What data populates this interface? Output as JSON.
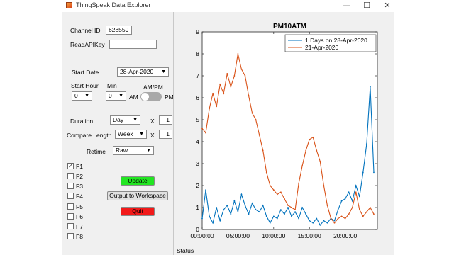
{
  "window": {
    "title": "ThingSpeak Data Explorer"
  },
  "controls": {
    "channel_id_label": "Channel ID",
    "channel_id_value": "628559",
    "read_api_key_label": "ReadAPIKey",
    "read_api_key_value": "",
    "start_date_label": "Start Date",
    "start_date_value": "28-Apr-2020",
    "start_hour_label": "Start Hour",
    "start_hour_value": "0",
    "min_label": "Min",
    "min_value": "0",
    "ampm_label": "AM/PM",
    "am_label": "AM",
    "pm_label": "PM",
    "toggle_state": "AM",
    "duration_label": "Duration",
    "duration_value": "Day",
    "duration_x": "X",
    "duration_count": "1",
    "compare_label": "Compare Length",
    "compare_value": "Week",
    "compare_x": "X",
    "compare_count": "1",
    "retime_label": "Retime",
    "retime_value": "Raw",
    "fields": [
      {
        "label": "F1",
        "checked": true
      },
      {
        "label": "F2",
        "checked": false
      },
      {
        "label": "F3",
        "checked": false
      },
      {
        "label": "F4",
        "checked": false
      },
      {
        "label": "F5",
        "checked": false
      },
      {
        "label": "F6",
        "checked": false
      },
      {
        "label": "F7",
        "checked": false
      },
      {
        "label": "F8",
        "checked": false
      }
    ],
    "update_label": "Update",
    "output_label": "Output to Workspace",
    "quit_label": "Quit",
    "update_color": "#22e622",
    "quit_color": "#f21a1a"
  },
  "status_label": "Status",
  "chart_data": {
    "type": "line",
    "title": "PM10ATM",
    "xlabel": "",
    "ylabel": "",
    "ylim": [
      0,
      9
    ],
    "xlim": [
      0,
      24.5
    ],
    "x_unit": "hours since 00:00:00",
    "x_ticks": [
      "00:00:00",
      "05:00:00",
      "10:00:00",
      "15:00:00",
      "20:00:00"
    ],
    "y_ticks": [
      "0",
      "1",
      "2",
      "3",
      "4",
      "5",
      "6",
      "7",
      "8",
      "9"
    ],
    "legend_position": "top-right",
    "grid": false,
    "series": [
      {
        "name": "1 Days on 28-Apr-2020",
        "color": "#0072bd",
        "x": [
          0,
          0.5,
          1,
          1.5,
          2,
          2.5,
          3,
          3.5,
          4,
          4.5,
          5,
          5.5,
          6,
          6.5,
          7,
          7.5,
          8,
          8.5,
          9,
          9.5,
          10,
          10.5,
          11,
          11.5,
          12,
          12.5,
          13,
          13.5,
          14,
          14.5,
          15,
          15.5,
          16,
          16.5,
          17,
          17.5,
          18,
          18.5,
          19,
          19.5,
          20,
          20.5,
          21,
          21.5,
          22,
          22.5,
          23,
          23.5,
          24
        ],
        "y": [
          0.5,
          1.8,
          0.6,
          0.3,
          1.0,
          0.4,
          0.9,
          1.1,
          0.7,
          1.3,
          0.8,
          1.6,
          1.1,
          0.7,
          1.2,
          0.9,
          0.8,
          1.1,
          0.6,
          0.3,
          0.6,
          0.5,
          0.9,
          0.7,
          1.0,
          0.6,
          0.8,
          0.5,
          1.0,
          0.7,
          0.4,
          0.3,
          0.5,
          0.2,
          0.4,
          0.3,
          0.5,
          0.4,
          0.9,
          1.3,
          1.4,
          1.7,
          1.3,
          2.0,
          1.5,
          2.6,
          3.9,
          6.5,
          2.6
        ]
      },
      {
        "name": "21-Apr-2020",
        "color": "#d95319",
        "x": [
          0,
          0.5,
          1,
          1.5,
          2,
          2.5,
          3,
          3.5,
          4,
          4.5,
          5,
          5.5,
          6,
          6.5,
          7,
          7.5,
          8,
          8.5,
          9,
          9.5,
          10,
          10.5,
          11,
          11.5,
          12,
          12.5,
          13,
          13.5,
          14,
          14.5,
          15,
          15.5,
          16,
          16.5,
          17,
          17.5,
          18,
          18.5,
          19,
          19.5,
          20,
          20.5,
          21,
          21.5,
          22,
          22.5,
          23,
          23.5,
          24
        ],
        "y": [
          4.6,
          4.4,
          5.5,
          6.2,
          5.6,
          6.6,
          6.2,
          7.1,
          6.5,
          7.0,
          8.0,
          7.3,
          7.0,
          6.1,
          5.3,
          5.0,
          4.3,
          3.6,
          2.6,
          2.0,
          1.8,
          1.6,
          1.7,
          1.4,
          1.1,
          1.0,
          0.9,
          2.1,
          2.9,
          3.6,
          4.1,
          4.2,
          3.6,
          3.1,
          2.0,
          1.1,
          0.5,
          0.3,
          0.5,
          0.6,
          0.5,
          0.7,
          1.0,
          1.7,
          0.9,
          0.6,
          0.8,
          1.0,
          0.7
        ]
      }
    ]
  }
}
